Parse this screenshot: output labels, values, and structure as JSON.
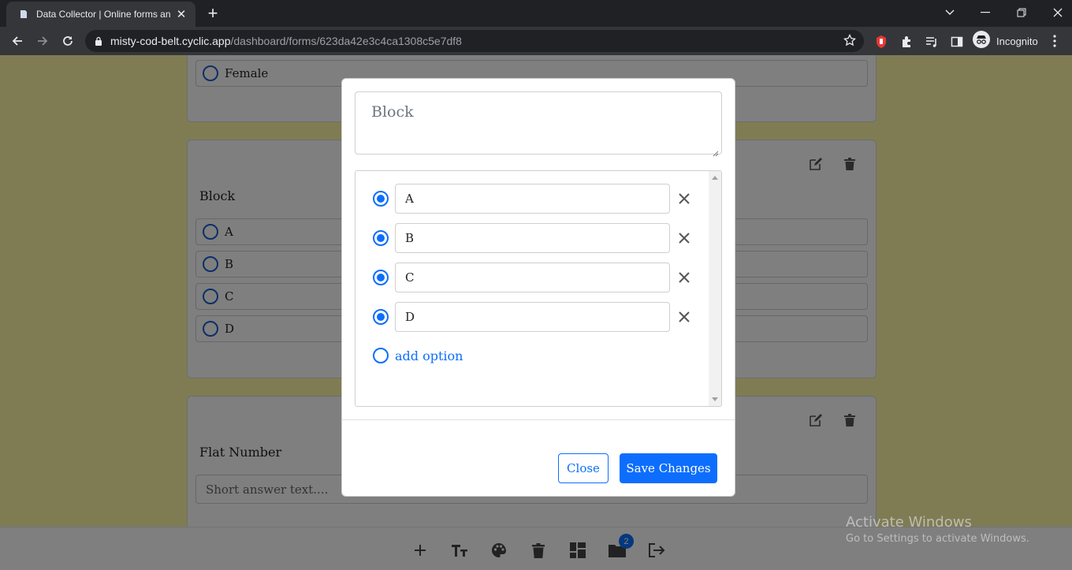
{
  "browser": {
    "tab_title": "Data Collector | Online forms and",
    "url_host": "misty-cod-belt.cyclic.app",
    "url_path": "/dashboard/forms/623da42e3c4ca1308c5e7df8",
    "profile_label": "Incognito"
  },
  "form": {
    "card1": {
      "option_label": "Female"
    },
    "card2": {
      "question": "Block",
      "options": [
        "A",
        "B",
        "C",
        "D"
      ]
    },
    "card3": {
      "question": "Flat Number",
      "placeholder": "Short answer text...."
    }
  },
  "bottom_toolbar": {
    "badge_count": "2"
  },
  "modal": {
    "question_text": "Block",
    "options": [
      "A",
      "B",
      "C",
      "D"
    ],
    "add_option_label": "add option",
    "close_label": "Close",
    "save_label": "Save Changes"
  },
  "watermark": {
    "title": "Activate Windows",
    "subtitle": "Go to Settings to activate Windows."
  },
  "colors": {
    "primary": "#0d6efd",
    "page_background": "#fff9a8"
  }
}
